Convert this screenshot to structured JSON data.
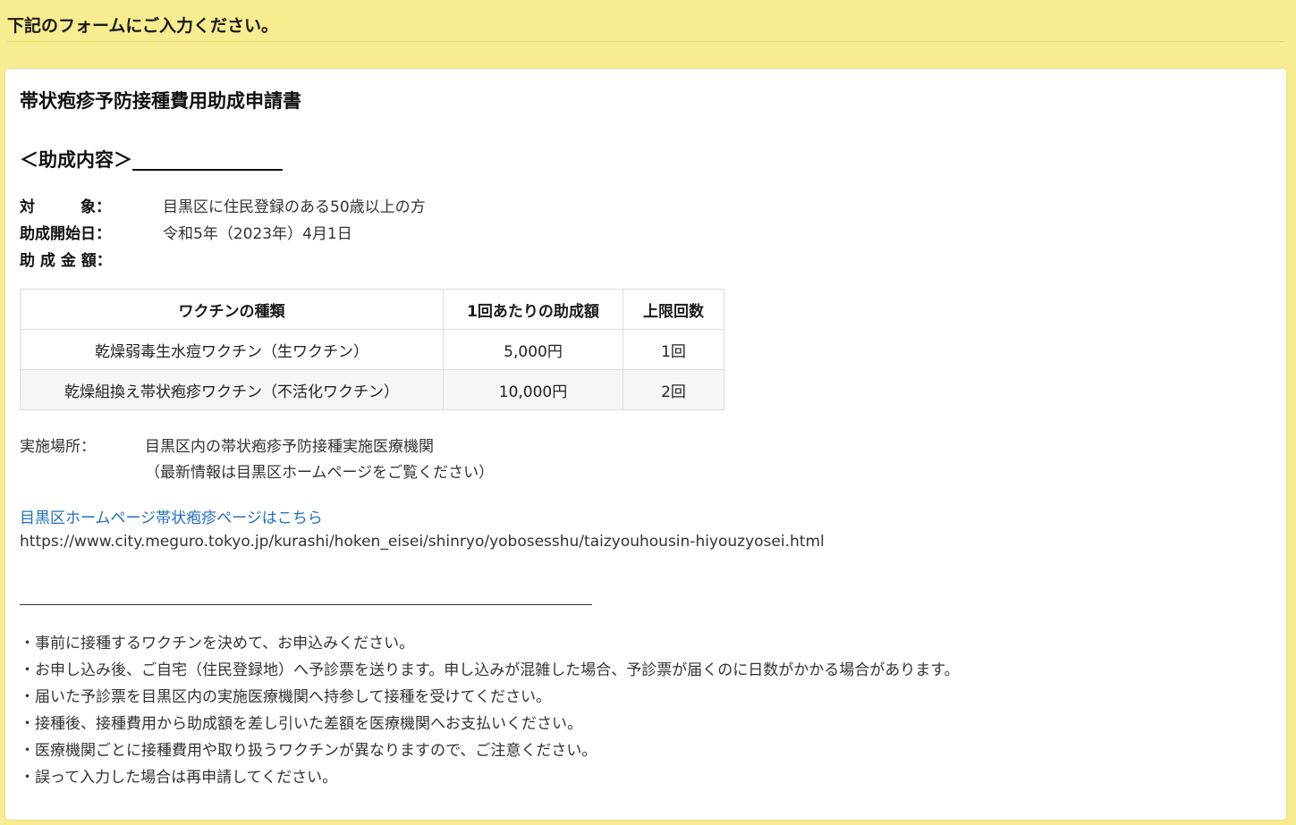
{
  "header": {
    "instruction": "下記のフォームにご入力ください。"
  },
  "form": {
    "title": "帯状疱疹予防接種費用助成申請書",
    "section_heading": "＜助成内容＞________________",
    "info": [
      {
        "label": "対　　　象：",
        "value": "目黒区に住民登録のある50歳以上の方"
      },
      {
        "label": "助成開始日：",
        "value": "令和5年（2023年）4月1日"
      },
      {
        "label": "助 成 金 額：",
        "value": ""
      }
    ],
    "table": {
      "headers": [
        "ワクチンの種類",
        "1回あたりの助成額",
        "上限回数"
      ],
      "rows": [
        [
          "乾燥弱毒生水痘ワクチン（生ワクチン）",
          "5,000円",
          "1回"
        ],
        [
          "乾燥組換え帯状疱疹ワクチン（不活化ワクチン）",
          "10,000円",
          "2回"
        ]
      ]
    },
    "place": {
      "label": "実施場所：",
      "value": "目黒区内の帯状疱疹予防接種実施医療機関",
      "note": "（最新情報は目黒区ホームページをご覧ください）"
    },
    "link_text": "目黒区ホームページ帯状疱疹ページはこちら",
    "url": "https://www.city.meguro.tokyo.jp/kurashi/hoken_eisei/shinryo/yobosesshu/taizyouhousin-hiyouzyosei.html",
    "notes": [
      "・事前に接種するワクチンを決めて、お申込みください。",
      "・お申し込み後、ご自宅（住民登録地）へ予診票を送ります。申し込みが混雑した場合、予診票が届くのに日数がかかる場合があります。",
      "・届いた予診票を目黒区内の実施医療機関へ持参して接種を受けてください。",
      "・接種後、接種費用から助成額を差し引いた差額を医療機関へお支払いください。",
      "・医療機関ごとに接種費用や取り扱うワクチンが異なりますので、ご注意ください。",
      "・誤って入力した場合は再申請してください。"
    ]
  },
  "colors": {
    "background": "#f7ec8f",
    "card": "#ffffff",
    "link": "#1f6fbf"
  }
}
